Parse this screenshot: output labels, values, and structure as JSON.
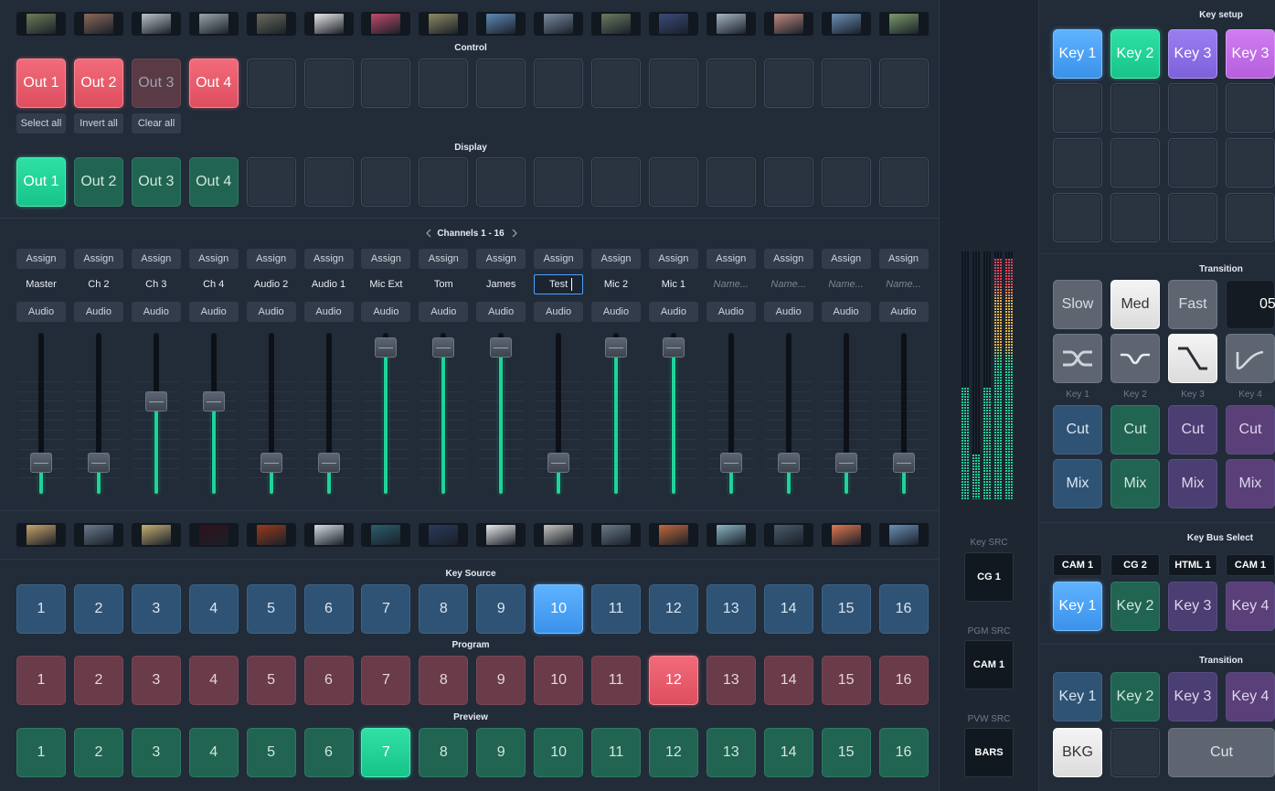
{
  "thumbs_top": [
    "#6f7d55",
    "#8a6a5a",
    "#b9c1c8",
    "#9aa4aa",
    "#6a6a5a",
    "#e8e8e8",
    "#c04a6a",
    "#8f8a62",
    "#5e8ab5",
    "#7a8aa0",
    "#6b7a60",
    "#3b4a7a",
    "#a6b4c2",
    "#c08a80",
    "#6a8fb5",
    "#7c9a6a"
  ],
  "thumbs_bottom": [
    "#c9a46a",
    "#6a7a8c",
    "#c4ae72",
    "#30101a",
    "#9a3a1a",
    "#d8dde2",
    "#2a5f6f",
    "#2a3a5a",
    "#e9e9e9",
    "#c4c4c0",
    "#6a7a85",
    "#c06a3a",
    "#8ab4c4",
    "#4a5a6a",
    "#e07850",
    "#6a90b4"
  ],
  "control": {
    "label": "Control",
    "outs": [
      "Out 1",
      "Out 2",
      "Out 3",
      "Out 4"
    ],
    "select_all": "Select all",
    "invert_all": "Invert all",
    "clear_all": "Clear all"
  },
  "display": {
    "label": "Display",
    "outs": [
      "Out 1",
      "Out 2",
      "Out 3",
      "Out 4"
    ]
  },
  "channels": {
    "nav_label": "Channels 1 - 16",
    "prev_icon": "chevron-left-icon",
    "next_icon": "chevron-right-icon",
    "assign_label": "Assign",
    "audio_label": "Audio",
    "names": [
      "Master",
      "Ch 2",
      "Ch 3",
      "Ch 4",
      "Audio 2",
      "Audio 1",
      "Mic Ext",
      "Tom",
      "James",
      "Test",
      "Mic 2",
      "Mic 1",
      "",
      "",
      "",
      ""
    ],
    "placeholder": "Name...",
    "fader_levels": [
      0.2,
      0.2,
      0.6,
      0.6,
      0.2,
      0.2,
      0.95,
      0.95,
      0.95,
      0.2,
      0.95,
      0.95,
      0.2,
      0.2,
      0.2,
      0.2
    ]
  },
  "key_source": {
    "label": "Key Source",
    "numbers": [
      "1",
      "2",
      "3",
      "4",
      "5",
      "6",
      "7",
      "8",
      "9",
      "10",
      "11",
      "12",
      "13",
      "14",
      "15",
      "16"
    ],
    "active": 10
  },
  "program": {
    "label": "Program",
    "numbers": [
      "1",
      "2",
      "3",
      "4",
      "5",
      "6",
      "7",
      "8",
      "9",
      "10",
      "11",
      "12",
      "13",
      "14",
      "15",
      "16"
    ],
    "active": 12
  },
  "preview": {
    "label": "Preview",
    "numbers": [
      "1",
      "2",
      "3",
      "4",
      "5",
      "6",
      "7",
      "8",
      "9",
      "10",
      "11",
      "12",
      "13",
      "14",
      "15",
      "16"
    ],
    "active": 7
  },
  "meters": {
    "levels": [
      0.45,
      0.18,
      0.45,
      0.97,
      0.97
    ],
    "peak_red": 0.85
  },
  "sources": {
    "key_src_label": "Key SRC",
    "key_src_value": "CG 1",
    "pgm_src_label": "PGM SRC",
    "pgm_src_value": "CAM 1",
    "pvw_src_label": "PVW SRC",
    "pvw_src_value": "BARS"
  },
  "key_setup": {
    "label": "Key setup",
    "keys": [
      "Key 1",
      "Key 2",
      "Key 3",
      "Key 3"
    ]
  },
  "transition": {
    "label": "Transition",
    "speeds": [
      "Slow",
      "Med",
      "Fast"
    ],
    "speed_value": "05",
    "curve_icons": [
      "shuffle-icon",
      "valley-curve-icon",
      "step-down-curve-icon",
      "ease-up-curve-icon"
    ],
    "key_labels": [
      "Key 1",
      "Key 2",
      "Key 3",
      "Key 4"
    ],
    "cut_label": "Cut",
    "mix_label": "Mix"
  },
  "key_bus_select": {
    "label": "Key Bus Select",
    "sources": [
      "CAM 1",
      "CG 2",
      "HTML 1",
      "CAM 1"
    ],
    "keys": [
      "Key 1",
      "Key 2",
      "Key 3",
      "Key 4"
    ]
  },
  "transition2": {
    "label": "Transition",
    "keys": [
      "Key 1",
      "Key 2",
      "Key 3",
      "Key 4"
    ],
    "bkg_label": "BKG",
    "cut_label": "Cut"
  }
}
